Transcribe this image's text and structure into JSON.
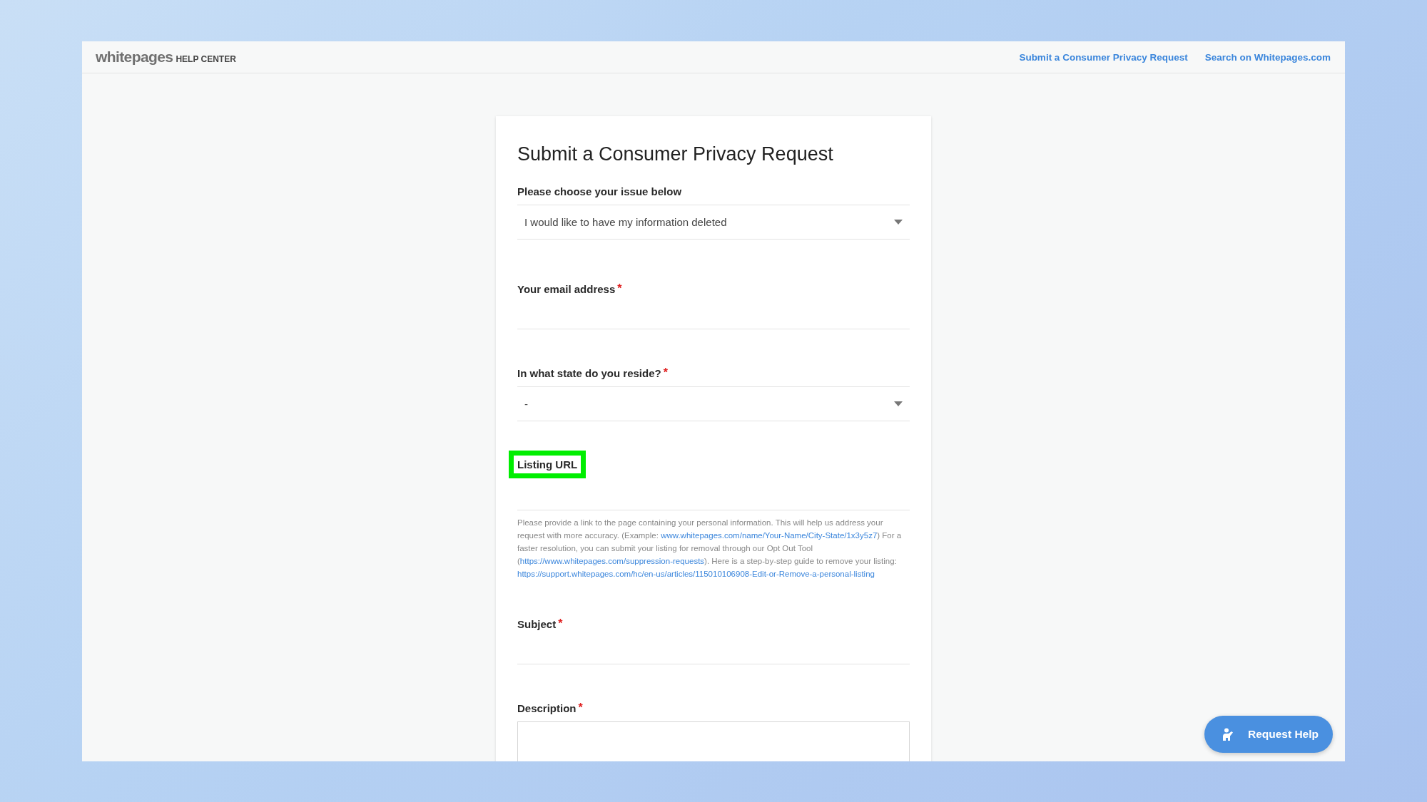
{
  "header": {
    "logo": "whitepages",
    "logo_suffix": "HELP CENTER",
    "links": [
      {
        "label": "Submit a Consumer Privacy Request"
      },
      {
        "label": "Search on Whitepages.com"
      }
    ]
  },
  "form": {
    "title": "Submit a Consumer Privacy Request",
    "fields": [
      {
        "kind": "select",
        "label": "Please choose your issue below",
        "value": "I would like to have my information deleted"
      },
      {
        "kind": "text",
        "label": "Your email address",
        "required_mark": "*"
      },
      {
        "kind": "select",
        "label": "In what state do you reside?",
        "required_mark": "*",
        "value": "-"
      },
      {
        "kind": "text",
        "label": "Listing URL",
        "highlighted": true,
        "hint": [
          {
            "kind": "text",
            "text": "Please provide a link to the page containing your personal information. This will help us address your request with more accuracy. (Example: "
          },
          {
            "kind": "link",
            "text": "www.whitepages.com/name/Your-Name/City-State/1x3y5z7"
          },
          {
            "kind": "text",
            "text": ") For a faster resolution, you can submit your listing for removal through our Opt Out Tool ("
          },
          {
            "kind": "link",
            "text": "https://www.whitepages.com/suppression-requests"
          },
          {
            "kind": "text",
            "text": "). Here is a step-by-step guide to remove your listing: "
          },
          {
            "kind": "link",
            "text": "https://support.whitepages.com/hc/en-us/articles/115010106908-Edit-or-Remove-a-personal-listing"
          }
        ]
      },
      {
        "kind": "text",
        "label": "Subject",
        "required_mark": "*"
      },
      {
        "kind": "textarea",
        "label": "Description",
        "required_mark": "*"
      }
    ]
  },
  "help_button": {
    "label": "Request Help"
  }
}
